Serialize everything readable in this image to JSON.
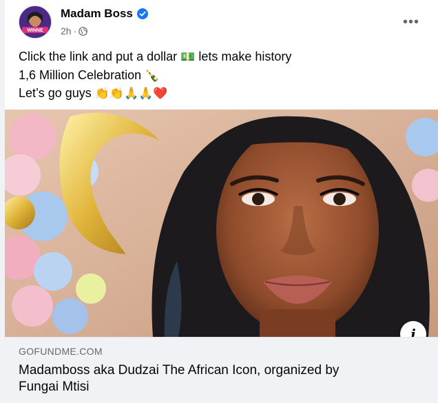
{
  "post": {
    "author": "Madam Boss",
    "avatar_text": "WINNE",
    "time": "2h",
    "audience_icon": "globe-icon",
    "verified_icon": "verified-badge-icon",
    "more_icon": "more-options-icon",
    "more_glyph": "•••",
    "text_line1": "Click the link and put a dollar",
    "text_line1_emoji": "💵",
    "text_line1_tail": "lets make history",
    "text_line2": "1,6 Million Celebration",
    "text_line2_emoji": "🍾",
    "text_line3": "Let’s go guys",
    "text_line3_emoji": "👏👏🙏🙏❤️"
  },
  "attachment": {
    "info_glyph": "i",
    "domain": "GOFUNDME.COM",
    "title_line1": "Madamboss aka Dudzai The African Icon, organized by",
    "title_line2": "Fungai Mtisi"
  },
  "colors": {
    "verified": "#1877f2",
    "secondary_text": "#65676b",
    "link_box_bg": "#f0f2f5"
  }
}
